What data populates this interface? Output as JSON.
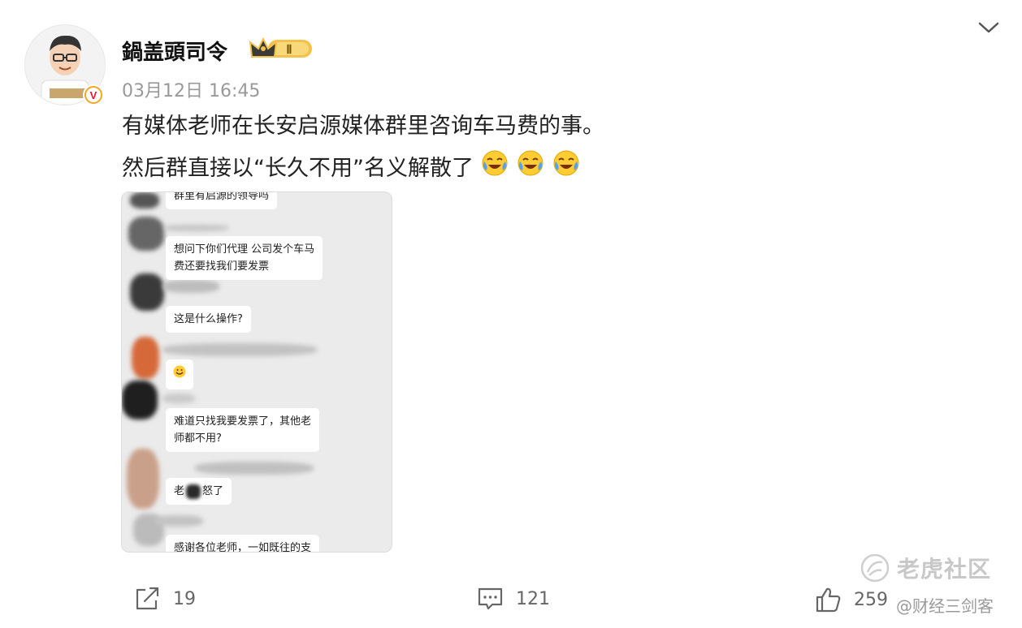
{
  "post": {
    "username": "鍋盖頭司令",
    "level_badge": "Ⅱ",
    "timestamp": "03月12日 16:45",
    "text_line1": "有媒体老师在长安启源媒体群里咨询车马费的事。",
    "text_line2": "然后群直接以“长久不用”名义解散了",
    "verified_mark": "V"
  },
  "screenshot": {
    "messages": [
      "群里有启源的领导吗",
      "想问下你们代理 公司发个车马",
      "费还要找我们要发票",
      "这是什么操作?",
      "难道只找我要发票了，其他老",
      "师都不用?",
      "老",
      "怒了",
      "感谢各位老师，一如既往的支"
    ]
  },
  "actions": {
    "repost_count": "19",
    "comment_count": "121",
    "like_count": "259"
  },
  "watermark": {
    "brand": "老虎社区",
    "handle": "@财经三剑客"
  },
  "colors": {
    "verified_gold": "#f5a623",
    "verified_red": "#e6162d",
    "badge_gold": "#f3c24a",
    "muted_text": "#999999"
  }
}
